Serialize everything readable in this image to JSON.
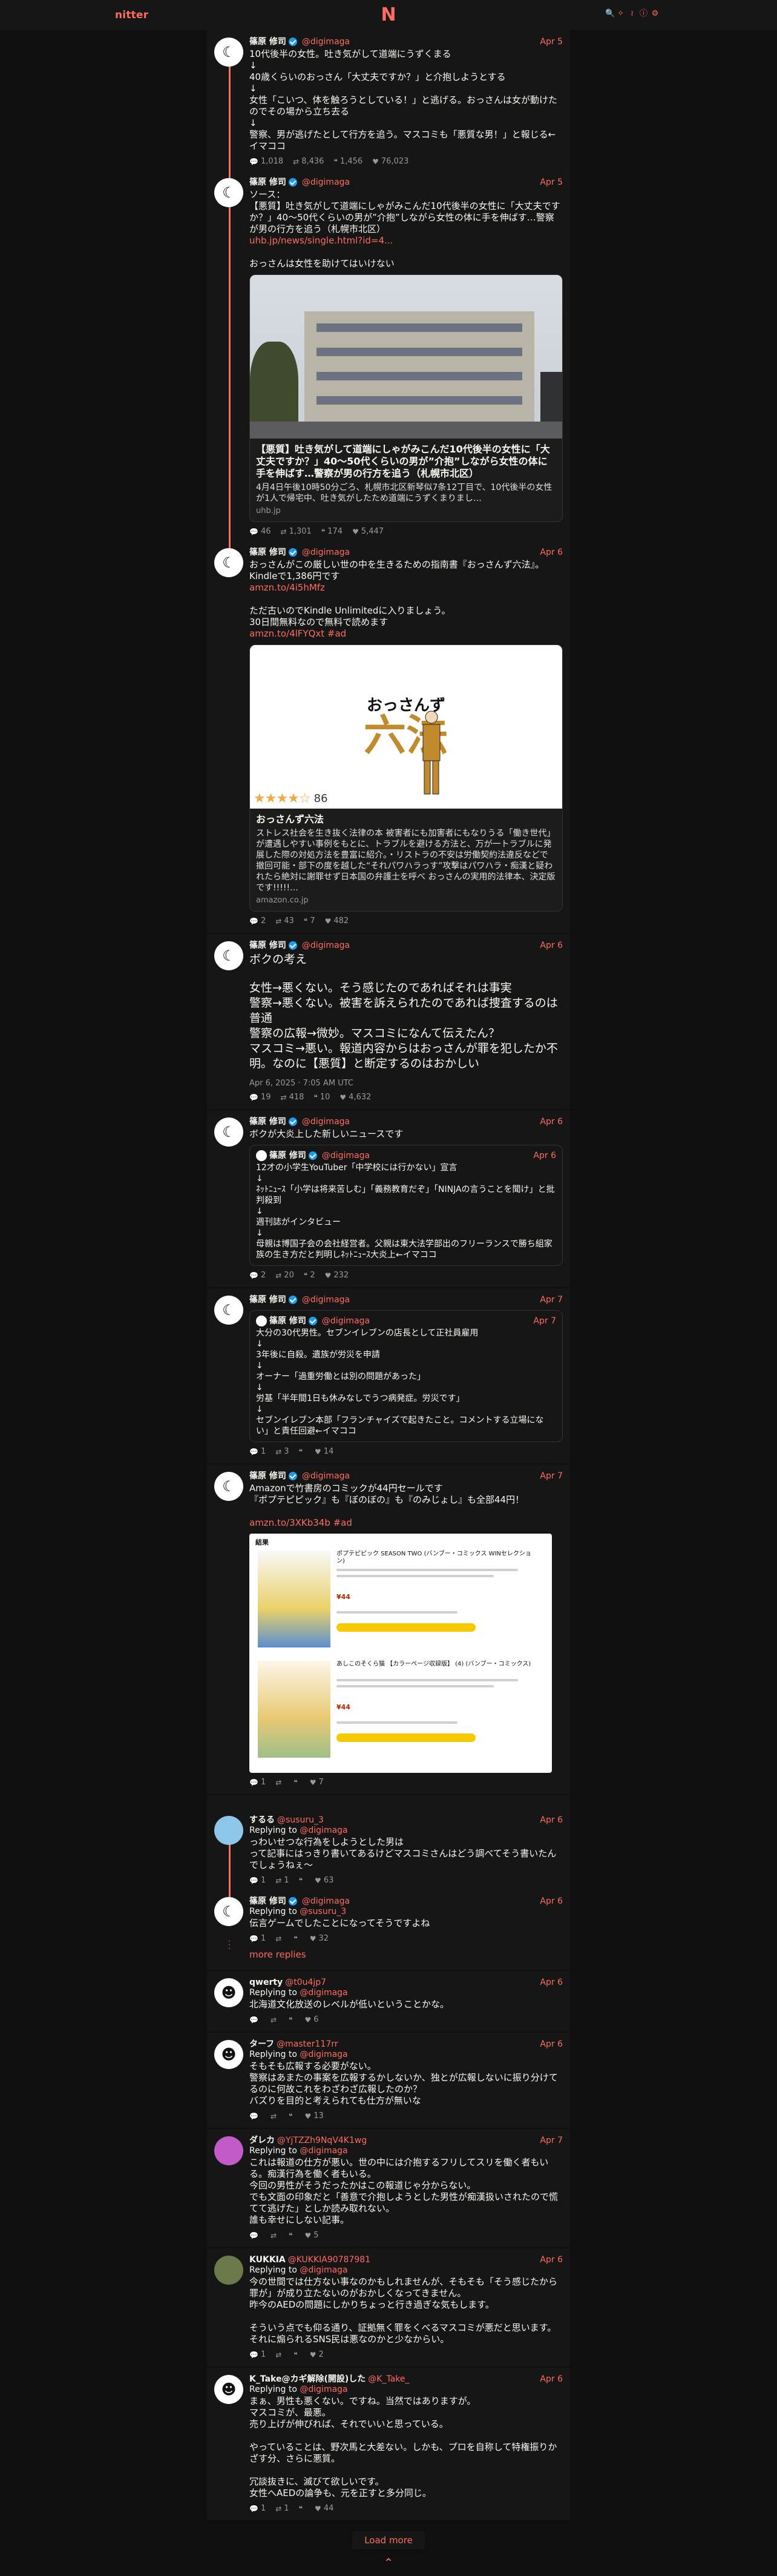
{
  "nav": {
    "logo": "nitter",
    "center": "N",
    "icons": [
      "search-icon",
      "rss-icon",
      "info-icon",
      "gear-icon"
    ]
  },
  "thread1": {
    "tweets": [
      {
        "fullname": "篠原 修司",
        "username": "@digimaga",
        "date": "Apr 5",
        "content": "10代後半の女性。吐き気がして道端にうずくまる\n↓\n40歳くらいのおっさん「大丈夫ですか？」と介抱しようとする\n↓\n女性「こいつ、体を触ろうとしている！」と逃げる。おっさんは女が動けたのでその場から立ち去る\n↓\n警察、男が逃げたとして行方を追う。マスコミも「悪質な男！」と報じる←イマココ",
        "stats": {
          "replies": "1,018",
          "retweets": "8,436",
          "quotes": "1,456",
          "likes": "76,023"
        }
      },
      {
        "fullname": "篠原 修司",
        "username": "@digimaga",
        "date": "Apr 5",
        "content": "ソース：\n【悪質】吐き気がして道端にしゃがみこんだ10代後半の女性に「大丈夫ですか？」40～50代くらいの男が”介抱”しながら女性の体に手を伸ばす…警察が男の行方を追う（札幌市北区）",
        "link": "uhb.jp/news/single.html?id=4...",
        "content2": "おっさんは女性を助けてはいけない",
        "card": {
          "title": "【悪質】吐き気がして道端にしゃがみこんだ10代後半の女性に「大丈夫ですか？」40～50代くらいの男が”介抱”しながら女性の体に手を伸ばす…警察が男の行方を追う（札幌市北区）",
          "desc": "4月4日午後10時50分ごろ、札幌市北区新琴似7条12丁目で、10代後半の女性が1人で帰宅中、吐き気がしたため道端にうずくまりまし…",
          "dest": "uhb.jp"
        },
        "stats": {
          "replies": "46",
          "retweets": "1,301",
          "quotes": "174",
          "likes": "5,447"
        }
      },
      {
        "fullname": "篠原 修司",
        "username": "@digimaga",
        "date": "Apr 6",
        "content": "おっさんがこの厳しい世の中を生きるための指南書『おっさんず六法』。Kindleで1,386円です",
        "link": "amzn.to/4i5hMfz",
        "content2": "ただ古いのでKindle Unlimitedに入りましょう。\n30日間無料なので無料で読めます",
        "link2": "amzn.to/4lFYQxt #ad",
        "card": {
          "book_title": "おっさんず",
          "book_law": "六法",
          "rating_count": "86",
          "title": "おっさんず六法",
          "desc": "ストレス社会を生き抜く法律の本 被害者にも加害者にもなりうる「働き世代」が遭遇しやすい事例をもとに、トラブルを避ける方法と、万が一トラブルに発展した際の対処方法を豊富に紹介。・リストラの不安は労働契約法違反などで撤回可能・部下の度を越した“それパワハラっす”攻撃はパワハラ・痴漢と疑われたら絶対に謝罪せず日本国の弁護士を呼べ おっさんの実用的法律本、決定版です!!!!!…",
          "dest": "amazon.co.jp"
        },
        "stats": {
          "replies": "2",
          "retweets": "43",
          "quotes": "7",
          "likes": "482"
        }
      }
    ]
  },
  "tweet_main": {
    "fullname": "篠原 修司",
    "username": "@digimaga",
    "date": "Apr 6",
    "content_title": "ボクの考え",
    "content": "女性→悪くない。そう感じたのであればそれは事実\n警察→悪くない。被害を訴えられたのであれば捜査するのは普通\n警察の広報→微妙。マスコミになんて伝えたん？\nマスコミ→悪い。報道内容からはおっさんが罪を犯したか不明。なのに【悪質】と断定するのはおかしい",
    "timestamp": "Apr 6, 2025 · 7:05 AM UTC",
    "stats": {
      "replies": "19",
      "retweets": "418",
      "quotes": "10",
      "likes": "4,632"
    }
  },
  "tweet_quote1": {
    "fullname": "篠原 修司",
    "username": "@digimaga",
    "date": "Apr 6",
    "content": "ボクが大炎上した新しいニュースです",
    "quote": {
      "fullname": "篠原 修司",
      "username": "@digimaga",
      "date": "Apr 6",
      "content": "12才の小学生YouTuber「中学校には行かない」宣言\n↓\nﾈｯﾄﾆｭｰｽ「小学は将来苦しむ」「義務教育だぞ」「NINJAの言うことを聞け」と批判殺到\n↓\n週刊誌がインタビュー\n↓\n母親は博国子会の会社経営者。父親は東大法学部出のフリーランスで勝ち組家族の生き方だと判明しﾈｯﾄﾆｭｰｽ大炎上←イマココ"
    },
    "stats": {
      "replies": "2",
      "retweets": "20",
      "quotes": "2",
      "likes": "232"
    }
  },
  "tweet_quote2": {
    "fullname": "篠原 修司",
    "username": "@digimaga",
    "date": "Apr 7",
    "quote": {
      "fullname": "篠原 修司",
      "username": "@digimaga",
      "date": "Apr 7",
      "content": "大分の30代男性。セブンイレブンの店長として正社員雇用\n↓\n3年後に自殺。遺族が労災を申請\n↓\nオーナー「過重労働とは別の問題があった」\n↓\n労基「半年間1日も休みなしでうつ病発症。労災です」\n↓\nセブンイレブン本部「フランチャイズで起きたこと。コメントする立場にない」と責任回避←イマココ"
    },
    "stats": {
      "replies": "1",
      "retweets": "3",
      "quotes": "",
      "likes": "14"
    }
  },
  "tweet_manga": {
    "fullname": "篠原 修司",
    "username": "@digimaga",
    "date": "Apr 7",
    "content": "Amazonで竹書房のコミックが44円セールです\n『ポプテピピック』も『ぼのぼの』も『のみじょし』も全部44円！",
    "link": "amzn.to/3XKb34b #ad",
    "manga": {
      "header": "結果",
      "title1": "ポプテピピック SEASON TWO (バンブー・コミックス WINセレクション)",
      "price1": "¥44",
      "title2": "あしこのそくら猫 【カラーページ収録版】 (4) (バンブー・コミックス)",
      "price2": "¥44"
    },
    "stats": {
      "replies": "1",
      "retweets": "",
      "quotes": "",
      "likes": "7"
    }
  },
  "thread_suru": {
    "tweets": [
      {
        "fullname": "するる",
        "username": "@susuru_3",
        "date": "Apr 6",
        "replying": "@digimaga",
        "content": "っわいせつな行為をしようとした男は\nって記事にはっきり書いてあるけどマスコミさんはどう調べてそう書いたんでしょうねぇ～",
        "stats": {
          "replies": "1",
          "retweets": "1",
          "quotes": "",
          "likes": "63"
        }
      },
      {
        "fullname": "篠原 修司",
        "username": "@digimaga",
        "date": "Apr 6",
        "replying": "@susuru_3",
        "content": "伝言ゲームでしたことになってそうですよね",
        "stats": {
          "replies": "1",
          "retweets": "",
          "quotes": "",
          "likes": "32"
        }
      }
    ],
    "more": "more replies"
  },
  "replies": [
    {
      "fullname": "qwerty",
      "username": "@t0u4jp7",
      "date": "Apr 6",
      "replying": "@digimaga",
      "content": "北海道文化放送のレベルが低いということかな。",
      "avatar": "default",
      "stats": {
        "replies": "",
        "retweets": "",
        "quotes": "",
        "likes": "6"
      }
    },
    {
      "fullname": "ターフ",
      "username": "@master117rr",
      "date": "Apr 6",
      "replying": "@digimaga",
      "content": "そもそも広報する必要がない。\n警察はあまたの事案を広報するかしないか、独とが広報しないに振り分けてるのに何故これをわざわざ広報したのか？\nバズりを目的と考えられても仕方が無いな",
      "avatar": "default",
      "stats": {
        "replies": "",
        "retweets": "",
        "quotes": "",
        "likes": "13"
      }
    },
    {
      "fullname": "ダレカ",
      "username": "@YjTZZh9NqV4K1wg",
      "date": "Apr 7",
      "replying": "@digimaga",
      "content": "これは報道の仕方が悪い。世の中には介抱するフリしてスリを働く者もいる。痴漢行為を働く者もいる。\n今回の男性がそうだったかはこの報道じゃ分からない。\nでも文面の印象だと「善意で介抱しようとした男性が痴漢扱いされたので慌てて逃げた」としか読み取れない。\n誰も幸せにしない記事。",
      "avatar": "dareka",
      "stats": {
        "replies": "",
        "retweets": "",
        "quotes": "",
        "likes": "5"
      }
    },
    {
      "fullname": "KUKKIA",
      "username": "@KUKKIA90787981",
      "date": "Apr 6",
      "replying": "@digimaga",
      "content": "今の世間では仕方ない事なのかもしれませんが、そもそも「そう感じたから罪が」が成り立たないのがおかしくなってきません。\n昨今のAEDの問題にしかりちょっと行き過ぎな気もします。\n\nそういう点でも仰る通り、証拠無く罪をくべるマスコミが悪だと思います。\nそれに煽られるSNS民は悪なのかと少なからい。",
      "avatar": "kukka",
      "stats": {
        "replies": "1",
        "retweets": "",
        "quotes": "",
        "likes": "2"
      }
    },
    {
      "fullname": "K_Take@カギ解除(開設)した",
      "username": "@K_Take_",
      "date": "Apr 6",
      "replying": "@digimaga",
      "content": "まぁ、男性も悪くない。ですね。当然ではありますが。\nマスコミが、最悪。\n売り上げが伸びれば、それでいいと思っている。\n\nやっていることは、野次馬と大差ない。しかも、プロを自称して特権振りかざす分、さらに悪質。\n\n冗談抜きに、滅びて欲しいです。\n女性へAEDの論争も、元を正すと多分同じ。",
      "avatar": "default",
      "stats": {
        "replies": "1",
        "retweets": "1",
        "quotes": "",
        "likes": "44"
      }
    }
  ],
  "load_more": "Load more",
  "to_top": "⌃",
  "colors": {
    "accent": "#ff6c60",
    "bg": "#0f0f0f",
    "panel": "#161616",
    "text": "#f8f8f2"
  }
}
